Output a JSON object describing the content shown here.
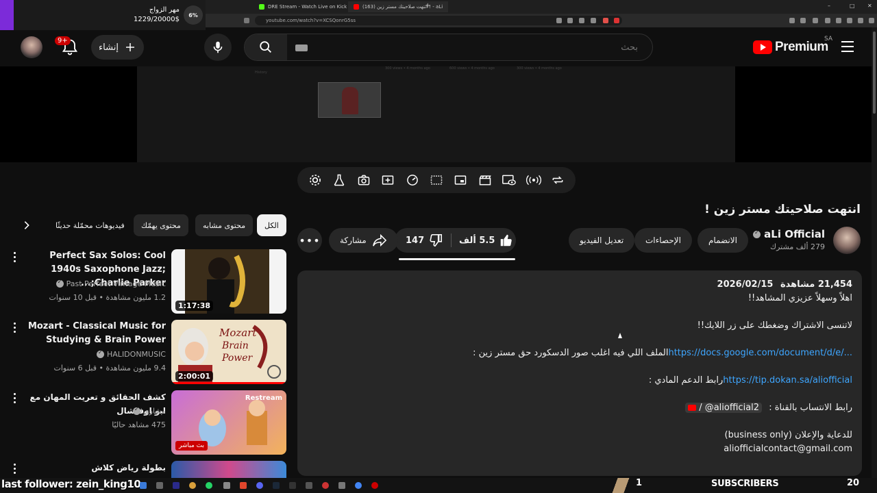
{
  "browser": {
    "tabs": [
      {
        "title": "DRE Stream - Watch Live on Kick"
      },
      {
        "title": "(163) انتهت صلاحيتك مستر زين ! - aLi"
      }
    ],
    "url": "youtube.com/watch?v=XCSQonrG5ss"
  },
  "donation": {
    "title": "مهر الزواج",
    "amount": "1229/20000$",
    "percent": "6%"
  },
  "masthead": {
    "create_label": "إنشاء",
    "notif_badge": "9+",
    "search_placeholder": "بحث",
    "logo_text": "Premium",
    "country": "SA"
  },
  "video": {
    "title": "انتهت صلاحيتك مستر زين !",
    "channel_name": "aLi Official",
    "subscribers": "279 ألف مشترك",
    "join_label": "الانضمام",
    "stats_label": "الإحصاءات",
    "edit_label": "تعديل الفيديو",
    "likes": "5.5 ألف",
    "dislikes": "147",
    "share_label": "مشاركة"
  },
  "player_ghost": {
    "history_label": "History",
    "views_a": "300 views • 4 months ago",
    "views_b": "600 views • 4 months ago",
    "views_c": "300 views • 4 months ago"
  },
  "description": {
    "views": "21,454",
    "views_label": "مشاهدة",
    "date": "2026/02/15",
    "line1": "اهلاً وسهلاً عزيزي المشاهد!!",
    "line2": "لاتنسى الاشتراك وضغطك على زر اللايك!!",
    "line3_text": "الملف اللي فيه اغلب صور الدسكورد حق مستر زين :",
    "line3_link": "https://docs.google.com/document/d/e/...",
    "line4_text": "رابط الدعم المادي :",
    "line4_link": "https://tip.dokan.sa/aliofficial",
    "line5_text": "رابط الانتساب بالقناة :",
    "line5_handle": "@aliofficial2",
    "line6": "للدعاية والإعلان (business only)",
    "line7": "aliofficialcontact@gmail.com"
  },
  "chips": [
    {
      "label": "الكل",
      "active": true
    },
    {
      "label": "محتوى مشابه"
    },
    {
      "label": "محتوى يهمّك"
    },
    {
      "label": "فيديوهات محمّلة حديثًا"
    }
  ],
  "related": [
    {
      "title": "Perfect Sax Solos: Cool 1940s Saxophone Jazz; Charlie Parker;...",
      "channel": "Past Perfect Vintage Music",
      "meta": "1.2 مليون مشاهدة • قبل 10 سنوات",
      "duration": "1:17:38"
    },
    {
      "title": "Mozart - Classical Music for Studying & Brain Power",
      "channel": "HALIDONMUSIC",
      "meta": "9.4 مليون مشاهدة • قبل 6 سنوات",
      "duration": "2:00:01",
      "thumb_text1": "Mozart",
      "thumb_text2": "Brain",
      "thumb_text3": "Power"
    },
    {
      "title": "كشف الحقائق و تعريت المهان مع ابو اوفيشال",
      "channel": "مشاري",
      "meta": "475 مشاهد حاليًا",
      "live_label": "بث مباشر",
      "restream_label": "Restream"
    },
    {
      "title": "بطولة رياض كلاش"
    }
  ],
  "stream_overlay": {
    "last_follower": "last follower: zein_king10",
    "follow_count": "1",
    "subscribers_label": "SUBSCRIBERS",
    "subscribers_count": "20"
  },
  "colors": {
    "accent_red": "#ff0000",
    "link_blue": "#3ea6ff",
    "donation_purple": "#7c2bd9"
  }
}
